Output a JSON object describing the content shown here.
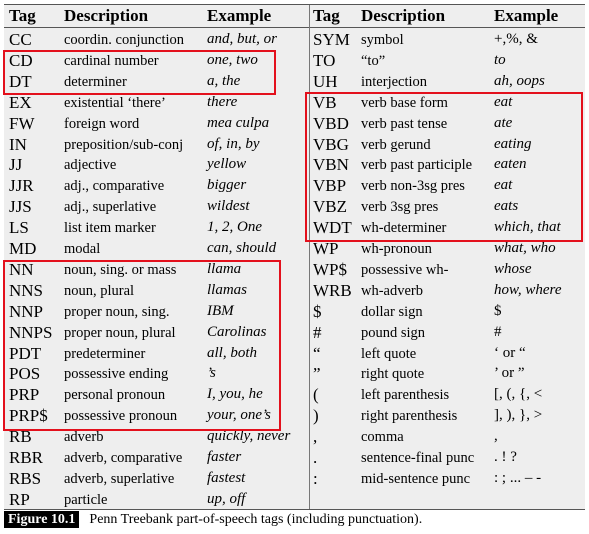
{
  "headers": [
    "Tag",
    "Description",
    "Example",
    "Tag",
    "Description",
    "Example"
  ],
  "left": [
    {
      "tag": "CC",
      "desc": "coordin. conjunction",
      "ex": "and, but, or"
    },
    {
      "tag": "CD",
      "desc": "cardinal number",
      "ex": "one, two"
    },
    {
      "tag": "DT",
      "desc": "determiner",
      "ex": "a, the"
    },
    {
      "tag": "EX",
      "desc": "existential ‘there’",
      "ex": "there"
    },
    {
      "tag": "FW",
      "desc": "foreign word",
      "ex": "mea culpa"
    },
    {
      "tag": "IN",
      "desc": "preposition/sub-conj",
      "ex": "of, in, by"
    },
    {
      "tag": "JJ",
      "desc": "adjective",
      "ex": "yellow"
    },
    {
      "tag": "JJR",
      "desc": "adj., comparative",
      "ex": "bigger"
    },
    {
      "tag": "JJS",
      "desc": "adj., superlative",
      "ex": "wildest"
    },
    {
      "tag": "LS",
      "desc": "list item marker",
      "ex": "1, 2, One"
    },
    {
      "tag": "MD",
      "desc": "modal",
      "ex": "can, should"
    },
    {
      "tag": "NN",
      "desc": "noun, sing. or mass",
      "ex": "llama"
    },
    {
      "tag": "NNS",
      "desc": "noun, plural",
      "ex": "llamas"
    },
    {
      "tag": "NNP",
      "desc": "proper noun, sing.",
      "ex": "IBM"
    },
    {
      "tag": "NNPS",
      "desc": "proper noun, plural",
      "ex": "Carolinas"
    },
    {
      "tag": "PDT",
      "desc": "predeterminer",
      "ex": "all, both"
    },
    {
      "tag": "POS",
      "desc": "possessive ending",
      "ex": "’s"
    },
    {
      "tag": "PRP",
      "desc": "personal pronoun",
      "ex": "I, you, he"
    },
    {
      "tag": "PRP$",
      "desc": "possessive pronoun",
      "ex": "your, one’s"
    },
    {
      "tag": "RB",
      "desc": "adverb",
      "ex": "quickly, never"
    },
    {
      "tag": "RBR",
      "desc": "adverb, comparative",
      "ex": "faster"
    },
    {
      "tag": "RBS",
      "desc": "adverb, superlative",
      "ex": "fastest"
    },
    {
      "tag": "RP",
      "desc": "particle",
      "ex": "up, off"
    }
  ],
  "right": [
    {
      "tag": "SYM",
      "desc": "symbol",
      "ex": "+,%, &",
      "upright": true
    },
    {
      "tag": "TO",
      "desc": "“to”",
      "ex": "to"
    },
    {
      "tag": "UH",
      "desc": "interjection",
      "ex": "ah, oops"
    },
    {
      "tag": "VB",
      "desc": "verb base form",
      "ex": "eat"
    },
    {
      "tag": "VBD",
      "desc": "verb past tense",
      "ex": "ate"
    },
    {
      "tag": "VBG",
      "desc": "verb gerund",
      "ex": "eating"
    },
    {
      "tag": "VBN",
      "desc": "verb past participle",
      "ex": "eaten"
    },
    {
      "tag": "VBP",
      "desc": "verb non-3sg pres",
      "ex": "eat"
    },
    {
      "tag": "VBZ",
      "desc": "verb 3sg pres",
      "ex": "eats"
    },
    {
      "tag": "WDT",
      "desc": "wh-determiner",
      "ex": "which, that"
    },
    {
      "tag": "WP",
      "desc": "wh-pronoun",
      "ex": "what, who"
    },
    {
      "tag": "WP$",
      "desc": "possessive wh-",
      "ex": "whose"
    },
    {
      "tag": "WRB",
      "desc": "wh-adverb",
      "ex": "how, where"
    },
    {
      "tag": "$",
      "desc": "dollar sign",
      "ex": "$",
      "upright": true
    },
    {
      "tag": "#",
      "desc": "pound sign",
      "ex": "#",
      "upright": true
    },
    {
      "tag": "“",
      "desc": "left quote",
      "ex": "‘ or “",
      "upright": true
    },
    {
      "tag": "”",
      "desc": "right quote",
      "ex": "’ or ”",
      "upright": true
    },
    {
      "tag": "(",
      "desc": "left parenthesis",
      "ex": "[, (, {, <",
      "upright": true
    },
    {
      "tag": ")",
      "desc": "right parenthesis",
      "ex": "], ), }, >",
      "upright": true
    },
    {
      "tag": ",",
      "desc": "comma",
      "ex": ",",
      "upright": true
    },
    {
      "tag": ".",
      "desc": "sentence-final punc",
      "ex": ". ! ?",
      "upright": true
    },
    {
      "tag": ":",
      "desc": "mid-sentence punc",
      "ex": ": ; ... – -",
      "upright": true
    }
  ],
  "highlight_color": "#e3101c",
  "caption": {
    "label": "Figure 10.1",
    "text": "Penn Treebank part-of-speech tags (including punctuation)."
  }
}
